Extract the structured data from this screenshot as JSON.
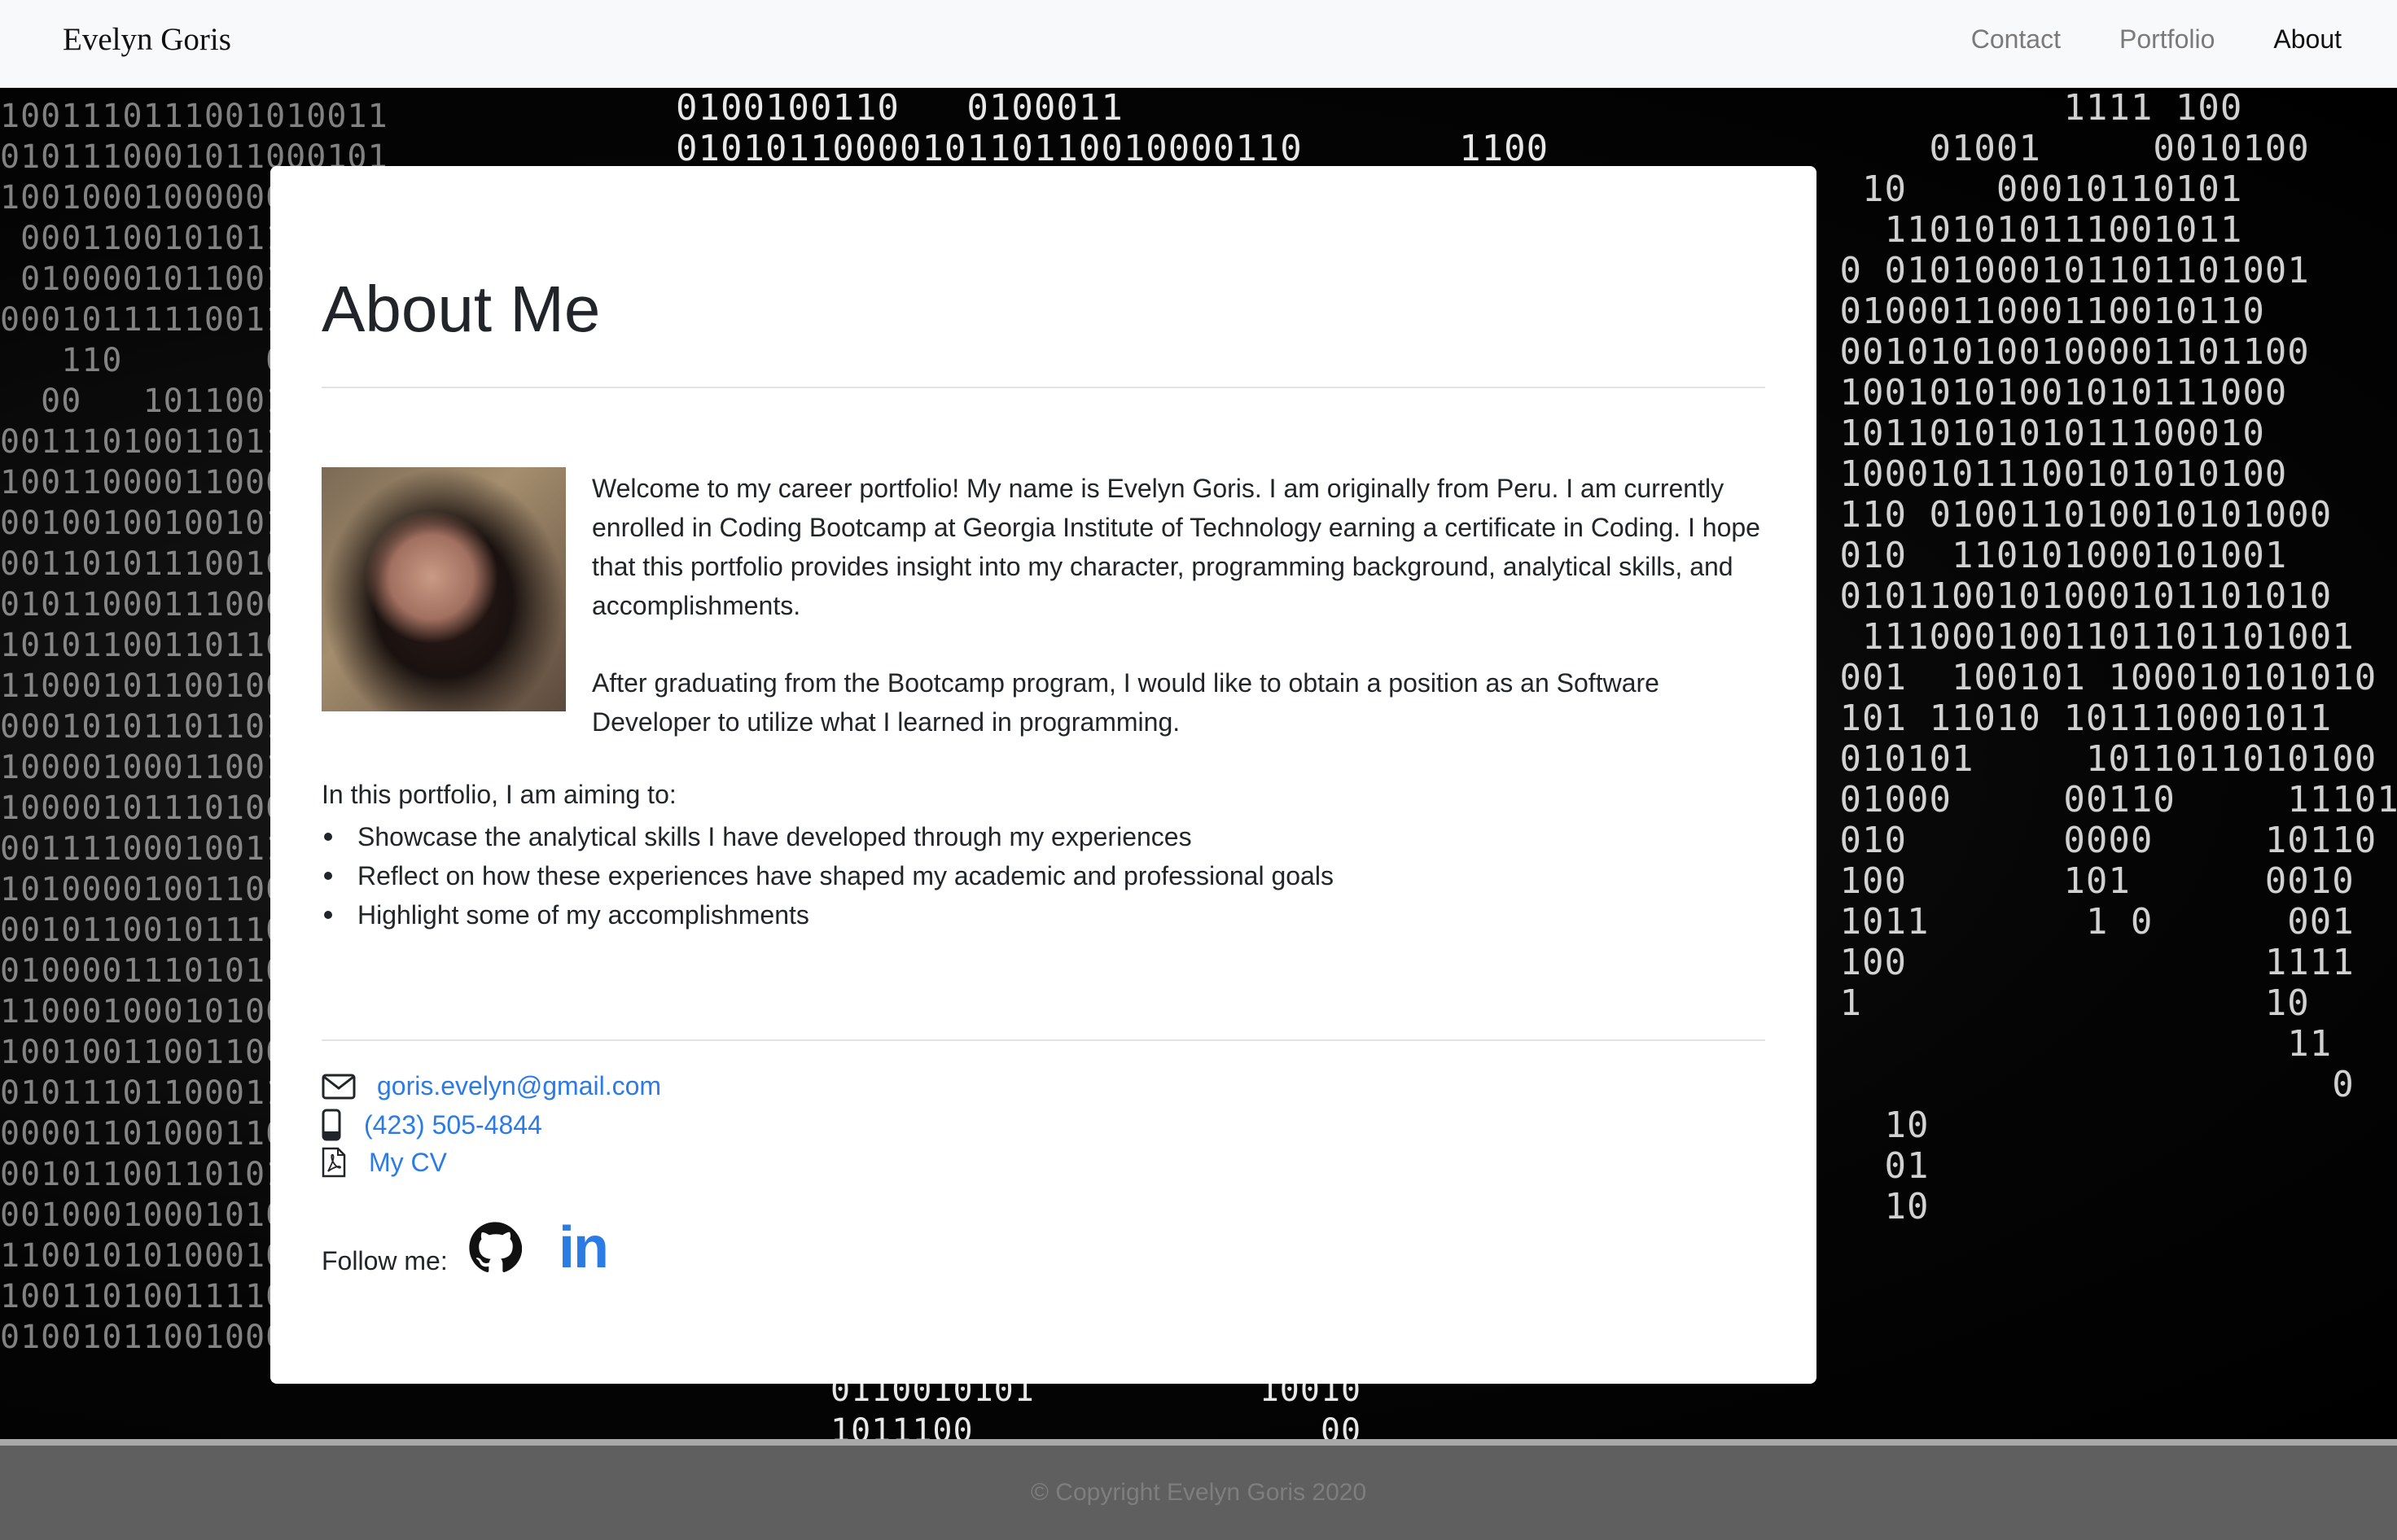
{
  "nav": {
    "brand": "Evelyn Goris",
    "links": [
      {
        "label": "Contact"
      },
      {
        "label": "Portfolio"
      },
      {
        "label": "About"
      }
    ]
  },
  "about": {
    "title": "About Me",
    "paragraph1": "Welcome to my career portfolio! My name is Evelyn Goris. I am originally from Peru. I am currently enrolled in Coding Bootcamp at Georgia Institute of Technology earning a certificate in Coding. I hope that this portfolio provides insight into my character, programming background, analytical skills, and accomplishments.",
    "paragraph2": "After graduating from the Bootcamp program, I would like to obtain a position as an Software Developer to utilize what I learned in programming.",
    "aims_intro": "In this portfolio, I am aiming to:",
    "aims": [
      "Showcase the analytical skills I have developed through my experiences",
      "Reflect on how these experiences have shaped my academic and professional goals",
      "Highlight some of my accomplishments"
    ]
  },
  "contact": {
    "email": "goris.evelyn@gmail.com",
    "phone": "(423) 505-4844",
    "cv": "My CV"
  },
  "social": {
    "follow_label": "Follow me:",
    "linkedin_text": "in"
  },
  "footer": {
    "copyright": "© Copyright Evelyn Goris 2020"
  },
  "colors": {
    "link": "#2c7be5",
    "text": "#212529",
    "navbar_bg": "#f8f9fa",
    "footer_bg": "#5f5f5f"
  }
}
